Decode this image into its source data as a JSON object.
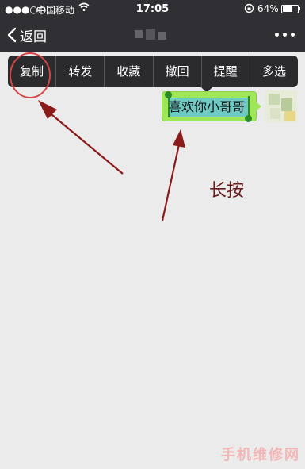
{
  "status_bar": {
    "signal": "●●●○○",
    "carrier": "中国移动",
    "time": "17:05",
    "battery_percent_text": "64%",
    "battery_level": 0.64
  },
  "nav": {
    "back_label": "返回"
  },
  "context_menu": {
    "items": [
      "复制",
      "转发",
      "收藏",
      "撤回",
      "提醒",
      "多选"
    ]
  },
  "message": {
    "text": "喜欢你小哥哥",
    "bubble_color": "#9fe658",
    "selection_color": "#5fc0e8"
  },
  "annotation": {
    "label": "长按",
    "arrow_color": "#8b1a1a",
    "circle_color": "#d64545"
  },
  "watermark": "手机维修网"
}
